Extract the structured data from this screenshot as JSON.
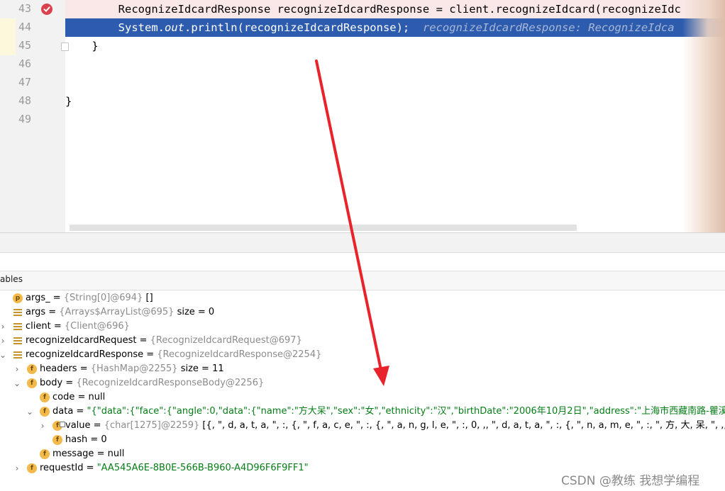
{
  "editor": {
    "lines": [
      {
        "num": "43",
        "code": "        RecognizeIdcardResponse recognizeIdcardResponse = client.recognizeIdcard(recognizeIdc",
        "breakpoint": true
      },
      {
        "num": "44",
        "code_pre": "        System.",
        "code_italic": "out",
        "code_post": ".println(recognizeIdcardResponse);  ",
        "hint": "recognizeIdcardResponse: RecognizeIdca",
        "current": true
      },
      {
        "num": "45",
        "code": "    }"
      },
      {
        "num": "46",
        "code": ""
      },
      {
        "num": "47",
        "code": ""
      },
      {
        "num": "48",
        "code": "}"
      },
      {
        "num": "49",
        "code": ""
      }
    ]
  },
  "debug": {
    "panel_label": "ables"
  },
  "variables": [
    {
      "icon": "p",
      "name": "args_",
      "op": " = ",
      "ref": "{String[0]@694}",
      "val": " []",
      "expandable": false
    },
    {
      "icon": "list",
      "name": "args",
      "op": " = ",
      "ref": "{Arrays$ArrayList@695}",
      "val": "  size = 0",
      "expandable": false
    },
    {
      "icon": "list",
      "name": "client",
      "op": " = ",
      "ref": "{Client@696}",
      "val": "",
      "expandable": true,
      "expanded": false
    },
    {
      "icon": "list",
      "name": "recognizeIdcardRequest",
      "op": " = ",
      "ref": "{RecognizeIdcardRequest@697}",
      "val": "",
      "expandable": true,
      "expanded": false
    },
    {
      "icon": "list",
      "name": "recognizeIdcardResponse",
      "op": " = ",
      "ref": "{RecognizeIdcardResponse@2254}",
      "val": "",
      "expandable": true,
      "expanded": true
    },
    {
      "icon": "f",
      "name": "headers",
      "op": " = ",
      "ref": "{HashMap@2255}",
      "val": "  size = 11",
      "expandable": true,
      "expanded": false
    },
    {
      "icon": "f",
      "name": "body",
      "op": " = ",
      "ref": "{RecognizeIdcardResponseBody@2256}",
      "val": "",
      "expandable": true,
      "expanded": true
    },
    {
      "icon": "f",
      "name": "code",
      "op": " = ",
      "ref": "",
      "val": "null",
      "expandable": false
    },
    {
      "icon": "f",
      "name": "data",
      "op": " = ",
      "ref": "",
      "str": "\"{\"data\":{\"face\":{\"angle\":0,\"data\":{\"name\":\"方大呆\",\"sex\":\"女\",\"ethnicity\":\"汉\",\"birthDate\":\"2006年10月2日\",\"address\":\"上海市西藏南路-瞿溪路弘辉名苑",
      "expandable": true,
      "expanded": true
    },
    {
      "icon": "f",
      "name": "value",
      "op": " = ",
      "ref": "{char[1275]@2259}",
      "val": " [{, \", d, a, t, a, \", :, {, \", f, a, c, e, \", :, {, \", a, n, g, l, e, \", :, 0, ,, \", d, a, t, a, \", :, {, \", n, a, m, e, \", :, \", 方, 大, 呆, \", ,, \", s, e, x, \", :, \", 女, \"",
      "expandable": true,
      "expanded": false,
      "locked": true
    },
    {
      "icon": "f",
      "name": "hash",
      "op": " = ",
      "ref": "",
      "val": "0",
      "expandable": false
    },
    {
      "icon": "f",
      "name": "message",
      "op": " = ",
      "ref": "",
      "val": "null",
      "expandable": false
    },
    {
      "icon": "f",
      "name": "requestId",
      "op": " = ",
      "ref": "",
      "str": "\"AA545A6E-8B0E-566B-B960-A4D96F6F9FF1\"",
      "expandable": true,
      "expanded": false
    }
  ],
  "watermark": "CSDN @教练 我想学编程",
  "colors": {
    "exec_line": "#2d5caf",
    "breakpoint_line": "#fae8e8",
    "breakpoint": "#d9414b",
    "string_value": "#067d17",
    "reference": "#8c8c8c",
    "field_icon": "#f3b94a",
    "arrow": "#e8232b"
  }
}
